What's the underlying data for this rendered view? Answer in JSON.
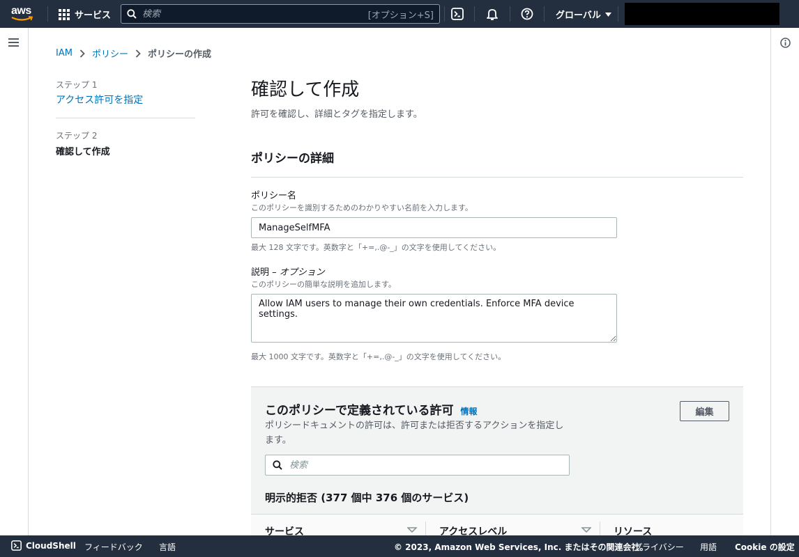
{
  "nav": {
    "logo": "aws",
    "services": "サービス",
    "search_placeholder": "検索",
    "search_shortcut": "[オプション+S]",
    "region": "グローバル"
  },
  "breadcrumb": {
    "root": "IAM",
    "parent": "ポリシー",
    "current": "ポリシーの作成"
  },
  "steps": {
    "step1_label": "ステップ 1",
    "step1_title": "アクセス許可を指定",
    "step2_label": "ステップ 2",
    "step2_title": "確認して作成"
  },
  "page": {
    "title": "確認して作成",
    "description": "許可を確認し、詳細とタグを指定します。"
  },
  "details": {
    "section_title": "ポリシーの詳細",
    "name_label": "ポリシー名",
    "name_desc": "このポリシーを識別するためのわかりやすい名前を入力します。",
    "name_value": "ManageSelfMFA",
    "name_hint": "最大 128 文字です。英数字と「+=,.@-_」の文字を使用してください。",
    "desc_label": "説明 – ",
    "desc_optional": "オプション",
    "desc_desc": "このポリシーの簡単な説明を追加します。",
    "desc_value": "Allow IAM users to manage their own credentials. Enforce MFA device settings.",
    "desc_hint": "最大 1000 文字です。英数字と「+=,.@-_」の文字を使用してください。"
  },
  "permissions": {
    "title": "このポリシーで定義されている許可",
    "info": "情報",
    "description": "ポリシードキュメントの許可は、許可または拒否するアクションを指定します。",
    "edit": "編集",
    "search_placeholder": "検索",
    "deny_header": "明示的拒否 (377 個中 376 個のサービス)",
    "columns": [
      "サービス",
      "アクセスレベル",
      "リソース"
    ]
  },
  "footer": {
    "cloudshell": "CloudShell",
    "feedback": "フィードバック",
    "language": "言語",
    "copyright": "© 2023, Amazon Web Services, Inc. またはその関連会社。",
    "privacy": "プライバシー",
    "terms": "用語",
    "cookie": "Cookie の設定"
  },
  "colors": {
    "nav_bg": "#232f3e",
    "link": "#0073bb",
    "panel_bg": "#f2f3f3"
  }
}
